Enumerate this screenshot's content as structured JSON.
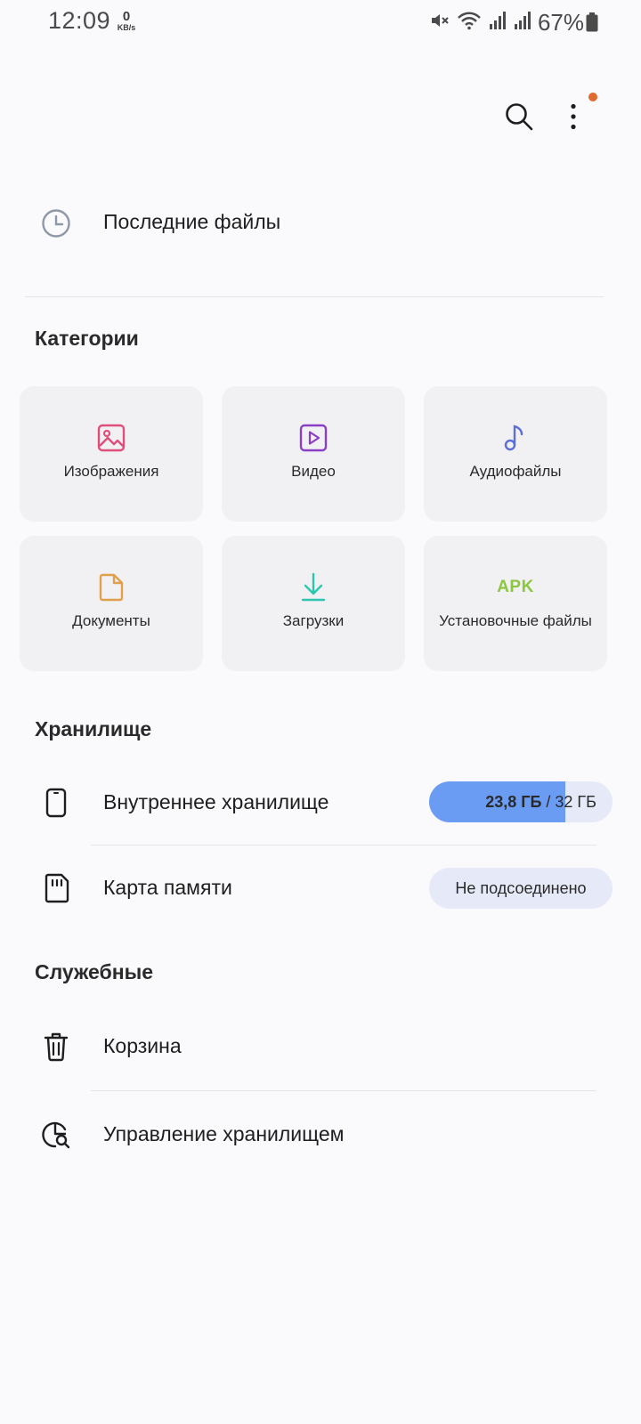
{
  "status_bar": {
    "time": "12:09",
    "net_speed_value": "0",
    "net_speed_unit": "KB/s",
    "battery_percent": "67%"
  },
  "recent": {
    "label": "Последние файлы"
  },
  "categories": {
    "title": "Категории",
    "items": [
      {
        "label": "Изображения",
        "icon": "image-icon",
        "color": "#e04e7a"
      },
      {
        "label": "Видео",
        "icon": "video-icon",
        "color": "#8a3fc6"
      },
      {
        "label": "Аудиофайлы",
        "icon": "music-note-icon",
        "color": "#5b6fd6"
      },
      {
        "label": "Документы",
        "icon": "document-icon",
        "color": "#e0a04a"
      },
      {
        "label": "Загрузки",
        "icon": "download-icon",
        "color": "#2cc6b0"
      },
      {
        "label": "Установочные файлы",
        "icon": "apk-icon",
        "icon_text": "APK",
        "color": "#8cc63f"
      }
    ]
  },
  "storage": {
    "title": "Хранилище",
    "internal": {
      "label": "Внутреннее хранилище",
      "used": "23,8 ГБ",
      "separator": " / ",
      "total": "32 ГБ",
      "used_fraction": 0.744
    },
    "sd_card": {
      "label": "Карта памяти",
      "status": "Не подсоединено"
    }
  },
  "utilities": {
    "title": "Служебные",
    "trash": "Корзина",
    "manage": "Управление хранилищем"
  },
  "colors": {
    "accent_bar": "#6b9cf4",
    "pill_bg": "#e6e9f8",
    "notification_dot": "#e0692e"
  }
}
